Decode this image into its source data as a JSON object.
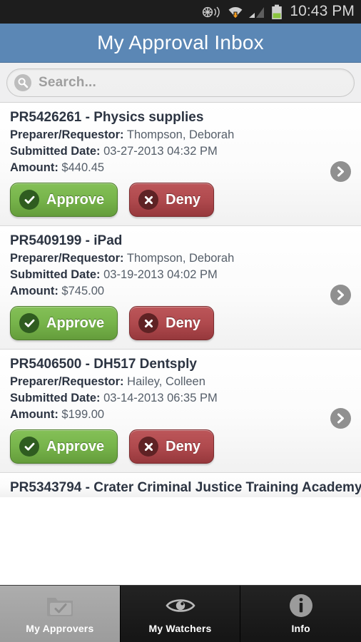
{
  "statusbar": {
    "time": "10:43 PM",
    "icons": [
      "gps-broadcast-icon",
      "wifi-download-icon",
      "cellular-signal-icon",
      "battery-icon"
    ]
  },
  "header": {
    "title": "My Approval Inbox",
    "bg_color": "#5b87b5"
  },
  "search": {
    "placeholder": "Search...",
    "value": "",
    "icon": "search-icon"
  },
  "labels": {
    "preparer": "Preparer/Requestor:",
    "submitted": "Submitted Date:",
    "amount": "Amount:",
    "approve": "Approve",
    "deny": "Deny",
    "chevron": "chevron-right-icon",
    "approve_icon": "check-circle-icon",
    "deny_icon": "x-circle-icon"
  },
  "colors": {
    "approve": "#77b44b",
    "deny": "#b04a4e",
    "chevron": "#909090",
    "accent": "#5b87b5"
  },
  "requests": [
    {
      "title": "PR5426261 - Physics supplies",
      "preparer": "Thompson, Deborah",
      "submitted": "03-27-2013 04:32 PM",
      "amount": "$440.45"
    },
    {
      "title": "PR5409199 - iPad",
      "preparer": "Thompson, Deborah",
      "submitted": "03-19-2013 04:02 PM",
      "amount": "$745.00"
    },
    {
      "title": "PR5406500 - DH517 Dentsply",
      "preparer": "Hailey, Colleen",
      "submitted": "03-14-2013 06:35 PM",
      "amount": "$199.00"
    },
    {
      "title": "PR5343794 - Crater Criminal Justice Training Academy"
    }
  ],
  "tabs": [
    {
      "label": "My Approvers",
      "icon": "folder-check-icon",
      "active": true
    },
    {
      "label": "My Watchers",
      "icon": "eye-icon",
      "active": false
    },
    {
      "label": "Info",
      "icon": "info-circle-icon",
      "active": false
    }
  ]
}
